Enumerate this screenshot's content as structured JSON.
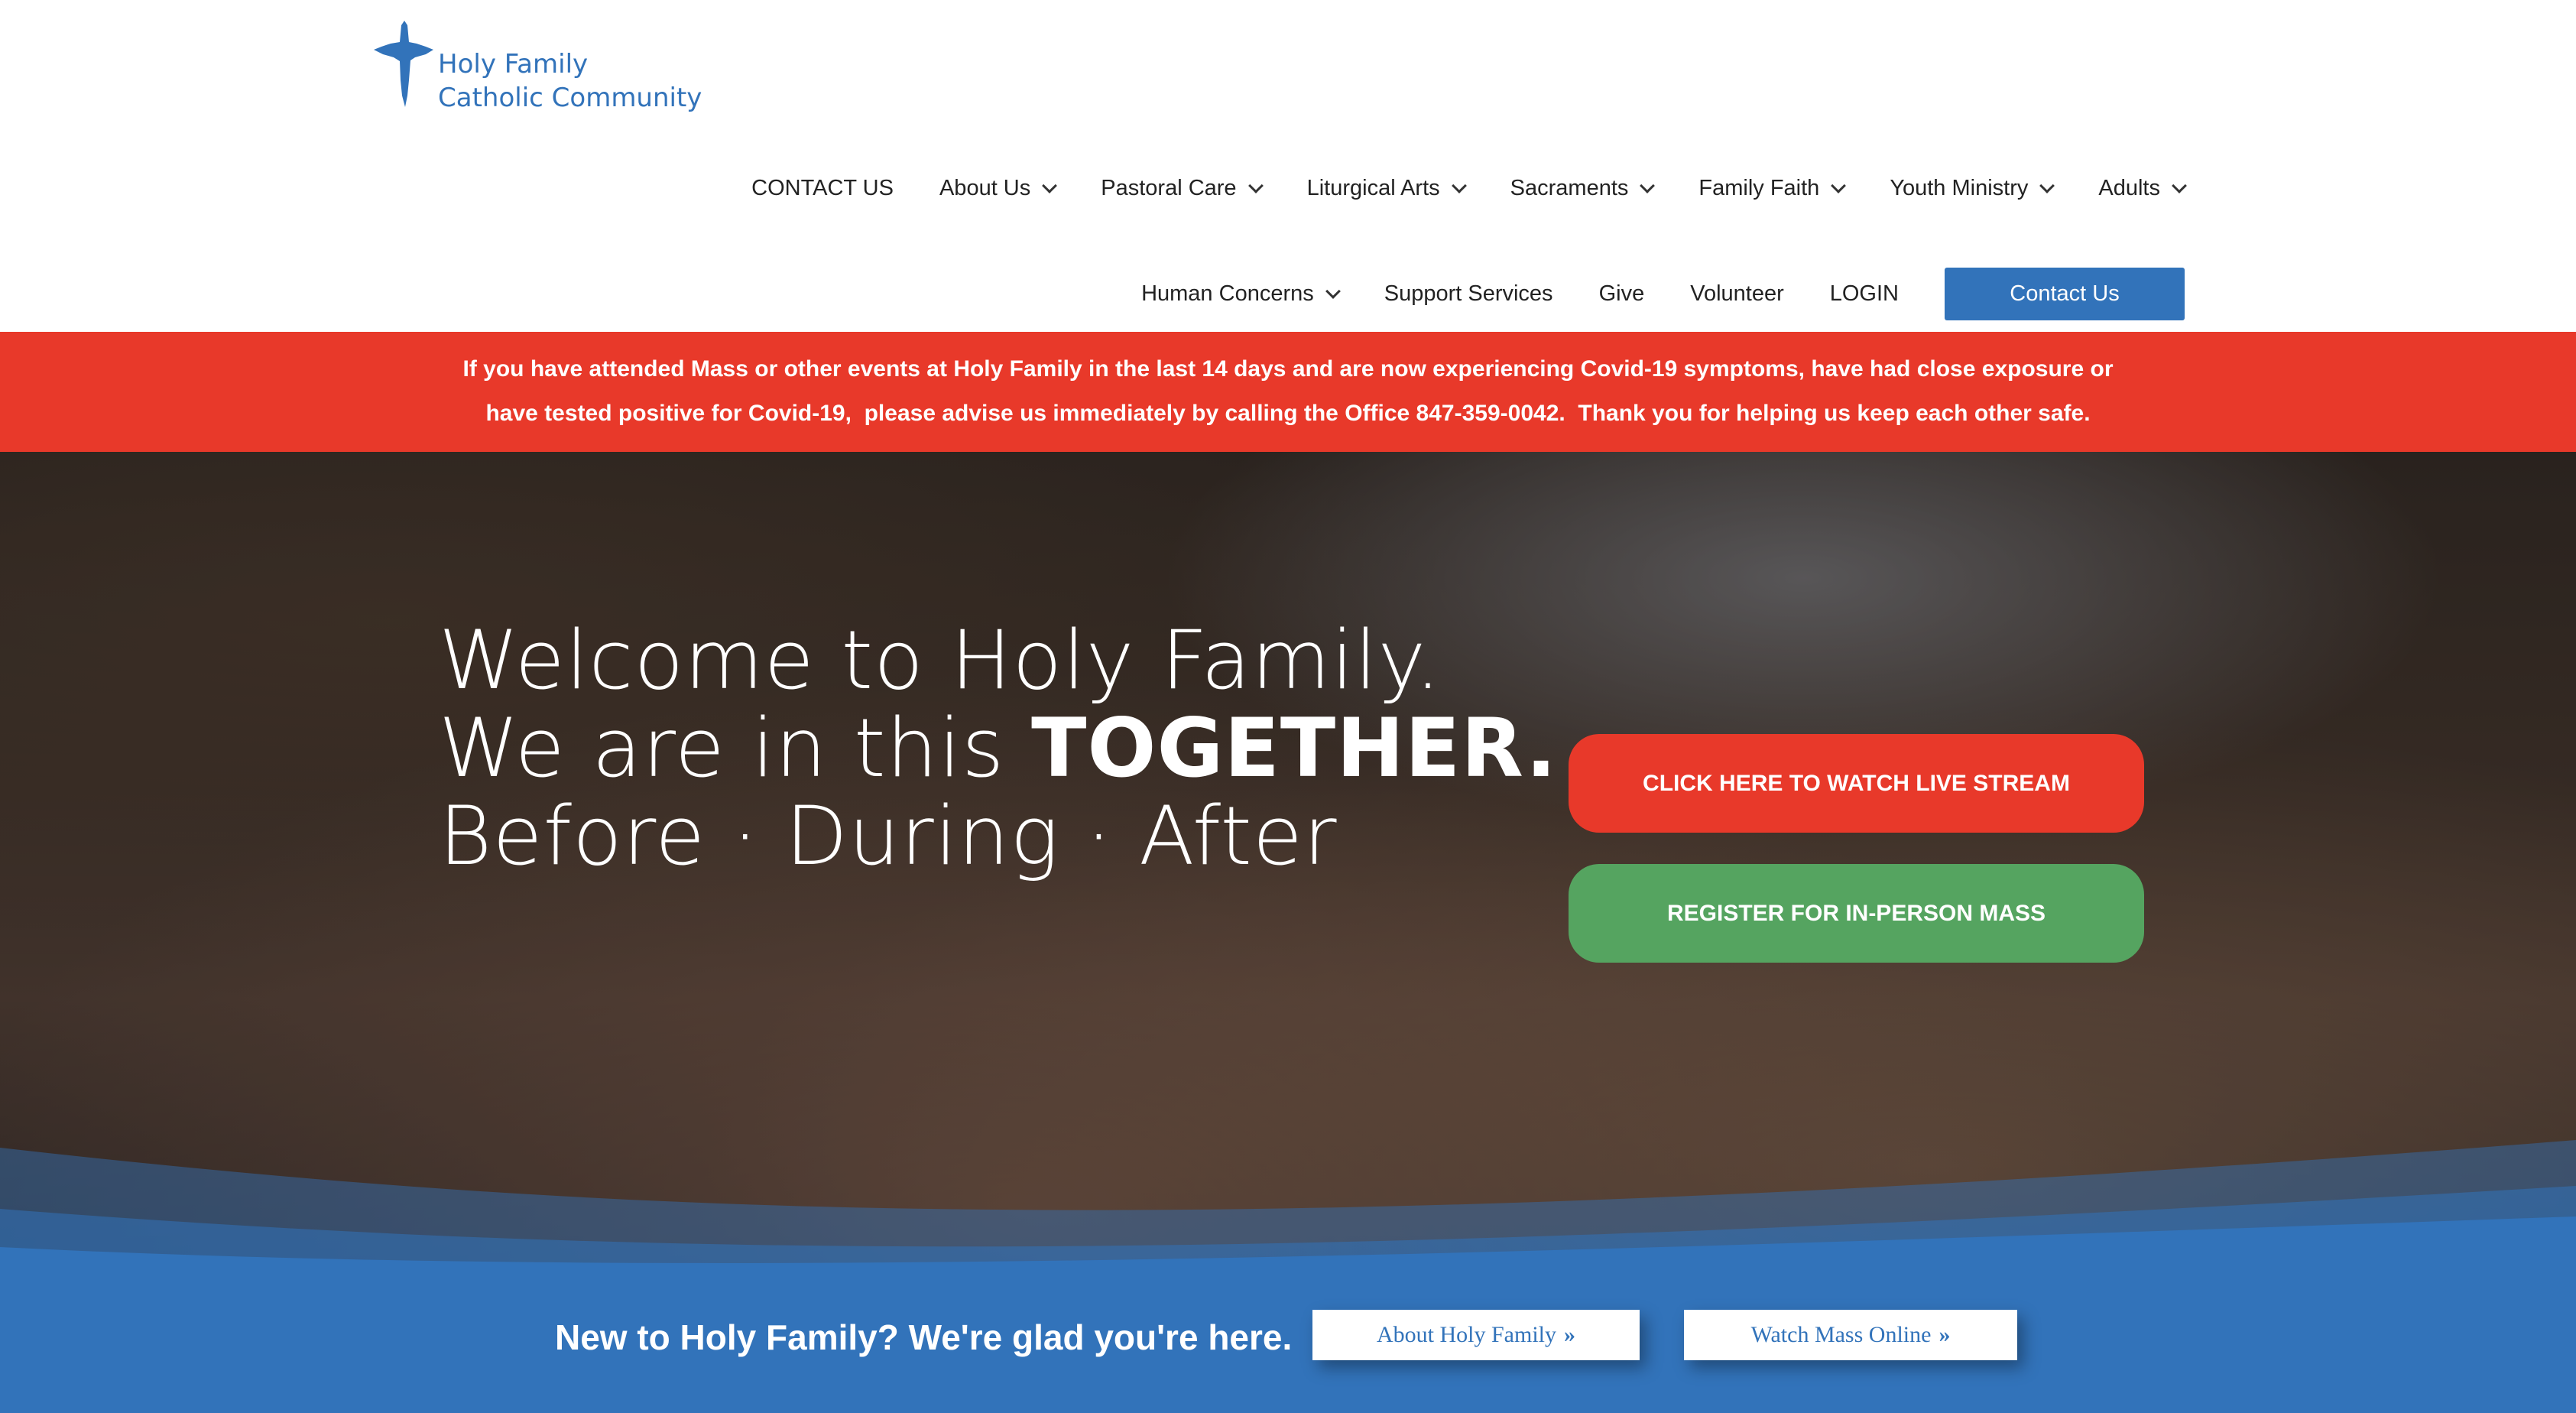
{
  "logo": {
    "line1": "Holy Family",
    "line2": "Catholic Community",
    "icon": "cross-icon",
    "color": "#3273ba"
  },
  "nav": {
    "row1": [
      {
        "label": "CONTACT US",
        "dropdown": false
      },
      {
        "label": "About Us",
        "dropdown": true
      },
      {
        "label": "Pastoral Care",
        "dropdown": true
      },
      {
        "label": "Liturgical Arts",
        "dropdown": true
      },
      {
        "label": "Sacraments",
        "dropdown": true
      },
      {
        "label": "Family Faith",
        "dropdown": true
      },
      {
        "label": "Youth Ministry",
        "dropdown": true
      },
      {
        "label": "Adults",
        "dropdown": true
      }
    ],
    "row2": [
      {
        "label": "Human Concerns",
        "dropdown": true
      },
      {
        "label": "Support Services",
        "dropdown": false
      },
      {
        "label": "Give",
        "dropdown": false
      },
      {
        "label": "Volunteer",
        "dropdown": false
      },
      {
        "label": "LOGIN",
        "dropdown": false
      }
    ],
    "contact_button": "Contact Us"
  },
  "alert": {
    "line1": "If you have attended Mass or other events at Holy Family in the last 14 days and are now experiencing Covid-19 symptoms, have had close exposure or",
    "line2": "have tested positive for Covid-19,  please advise us immediately by calling the Office 847-359-0042.  Thank you for helping us keep each other safe.",
    "color": "#e8392a"
  },
  "hero": {
    "line1": "Welcome to Holy Family.",
    "line2_pre": "We are in this ",
    "line2_bold": "TOGETHER.",
    "line3": "Before · During · After",
    "live_button": "CLICK HERE TO WATCH LIVE STREAM",
    "register_button": "REGISTER FOR IN-PERSON MASS"
  },
  "bottom": {
    "text": "New to Holy Family? We're glad you're here.",
    "about_button": "About Holy Family",
    "watch_button": "Watch Mass Online",
    "arrow": "»"
  }
}
